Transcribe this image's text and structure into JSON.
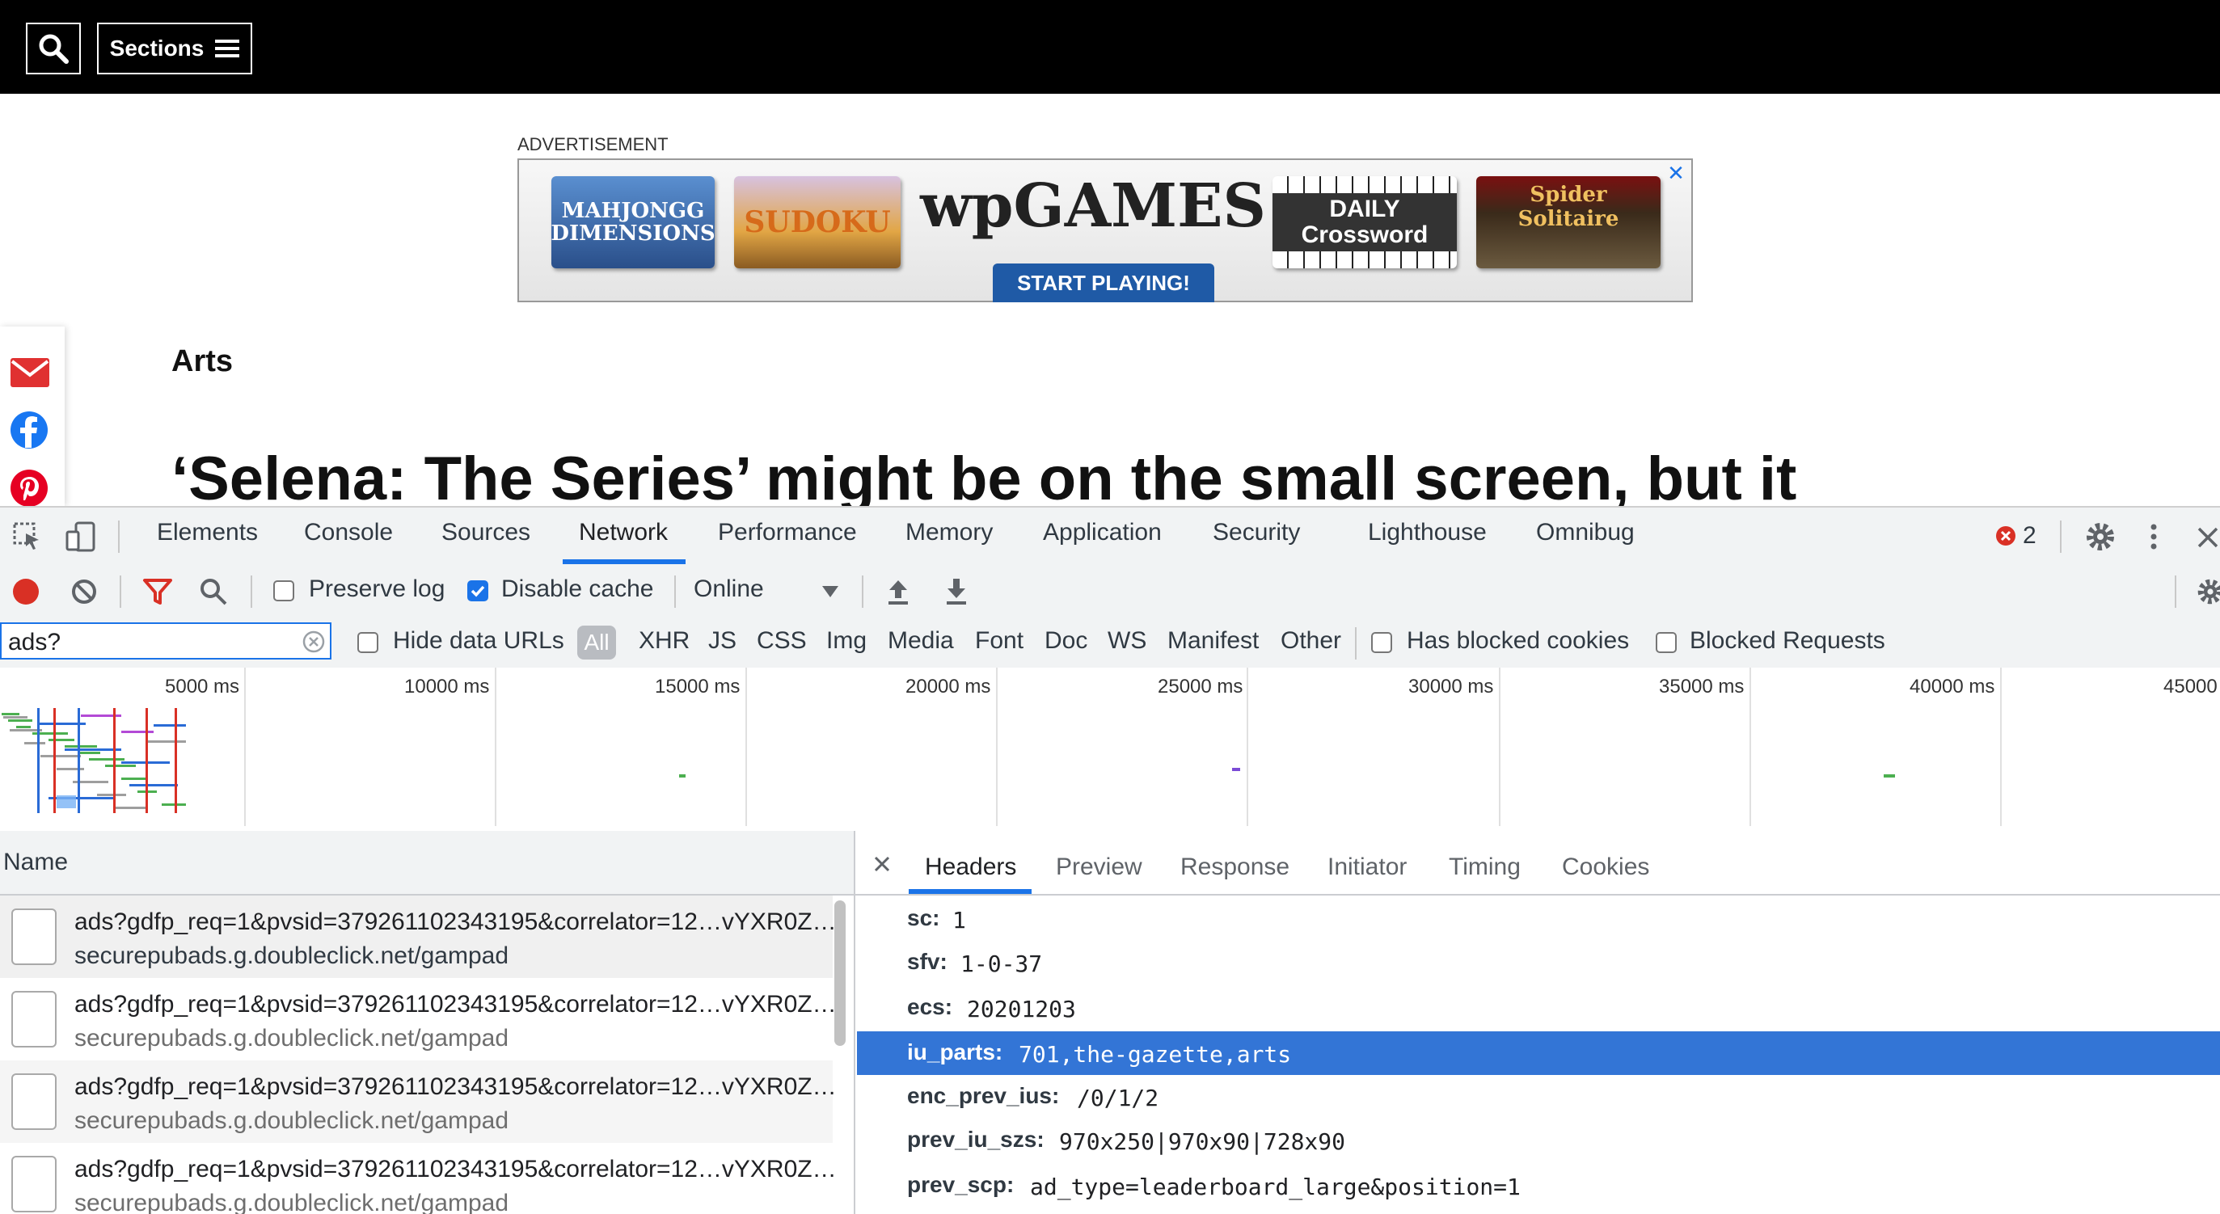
{
  "site": {
    "sections_label": "Sections",
    "ad_label": "ADVERTISEMENT",
    "ad": {
      "brand": "wpGAMES",
      "cta": "START PLAYING!",
      "games": [
        "MAHJONGG DIMENSIONS",
        "SUDOKU",
        "DAILY Crossword",
        "Spider Solitaire"
      ]
    },
    "article": {
      "section": "Arts",
      "headline": "‘Selena: The Series’ might be on the small screen, but it"
    }
  },
  "devtools": {
    "tabs": [
      "Elements",
      "Console",
      "Sources",
      "Network",
      "Performance",
      "Memory",
      "Application",
      "Security",
      "Lighthouse",
      "Omnibug"
    ],
    "active_tab": "Network",
    "error_count": "2",
    "toolbar": {
      "preserve_log": "Preserve log",
      "disable_cache": "Disable cache",
      "throttle": "Online"
    },
    "filter": {
      "value": "ads?",
      "hide_data_urls": "Hide data URLs",
      "types": [
        "All",
        "XHR",
        "JS",
        "CSS",
        "Img",
        "Media",
        "Font",
        "Doc",
        "WS",
        "Manifest",
        "Other"
      ],
      "has_blocked_cookies": "Has blocked cookies",
      "blocked_requests": "Blocked Requests"
    },
    "timeline_ticks": [
      "5000 ms",
      "10000 ms",
      "15000 ms",
      "20000 ms",
      "25000 ms",
      "30000 ms",
      "35000 ms",
      "40000 ms",
      "45000"
    ],
    "requests": {
      "column": "Name",
      "rows": [
        {
          "name": "ads?gdfp_req=1&pvsid=379261102343195&correlator=12…vYXR0Z…",
          "domain": "securepubads.g.doubleclick.net/gampad"
        },
        {
          "name": "ads?gdfp_req=1&pvsid=379261102343195&correlator=12…vYXR0Z…",
          "domain": "securepubads.g.doubleclick.net/gampad"
        },
        {
          "name": "ads?gdfp_req=1&pvsid=379261102343195&correlator=12…vYXR0Z…",
          "domain": "securepubads.g.doubleclick.net/gampad"
        },
        {
          "name": "ads?gdfp_req=1&pvsid=379261102343195&correlator=12…vYXR0Z…",
          "domain": "securepubads.g.doubleclick.net/gampad"
        }
      ]
    },
    "details": {
      "tabs": [
        "Headers",
        "Preview",
        "Response",
        "Initiator",
        "Timing",
        "Cookies"
      ],
      "active_tab": "Headers",
      "params": [
        {
          "key": "sc:",
          "value": "1"
        },
        {
          "key": "sfv:",
          "value": "1-0-37"
        },
        {
          "key": "ecs:",
          "value": "20201203"
        },
        {
          "key": "iu_parts:",
          "value": "701,the-gazette,arts"
        },
        {
          "key": "enc_prev_ius:",
          "value": "/0/1/2"
        },
        {
          "key": "prev_iu_szs:",
          "value": "970x250|970x90|728x90"
        },
        {
          "key": "prev_scp:",
          "value": "ad_type=leaderboard_large&position=1"
        }
      ]
    }
  }
}
